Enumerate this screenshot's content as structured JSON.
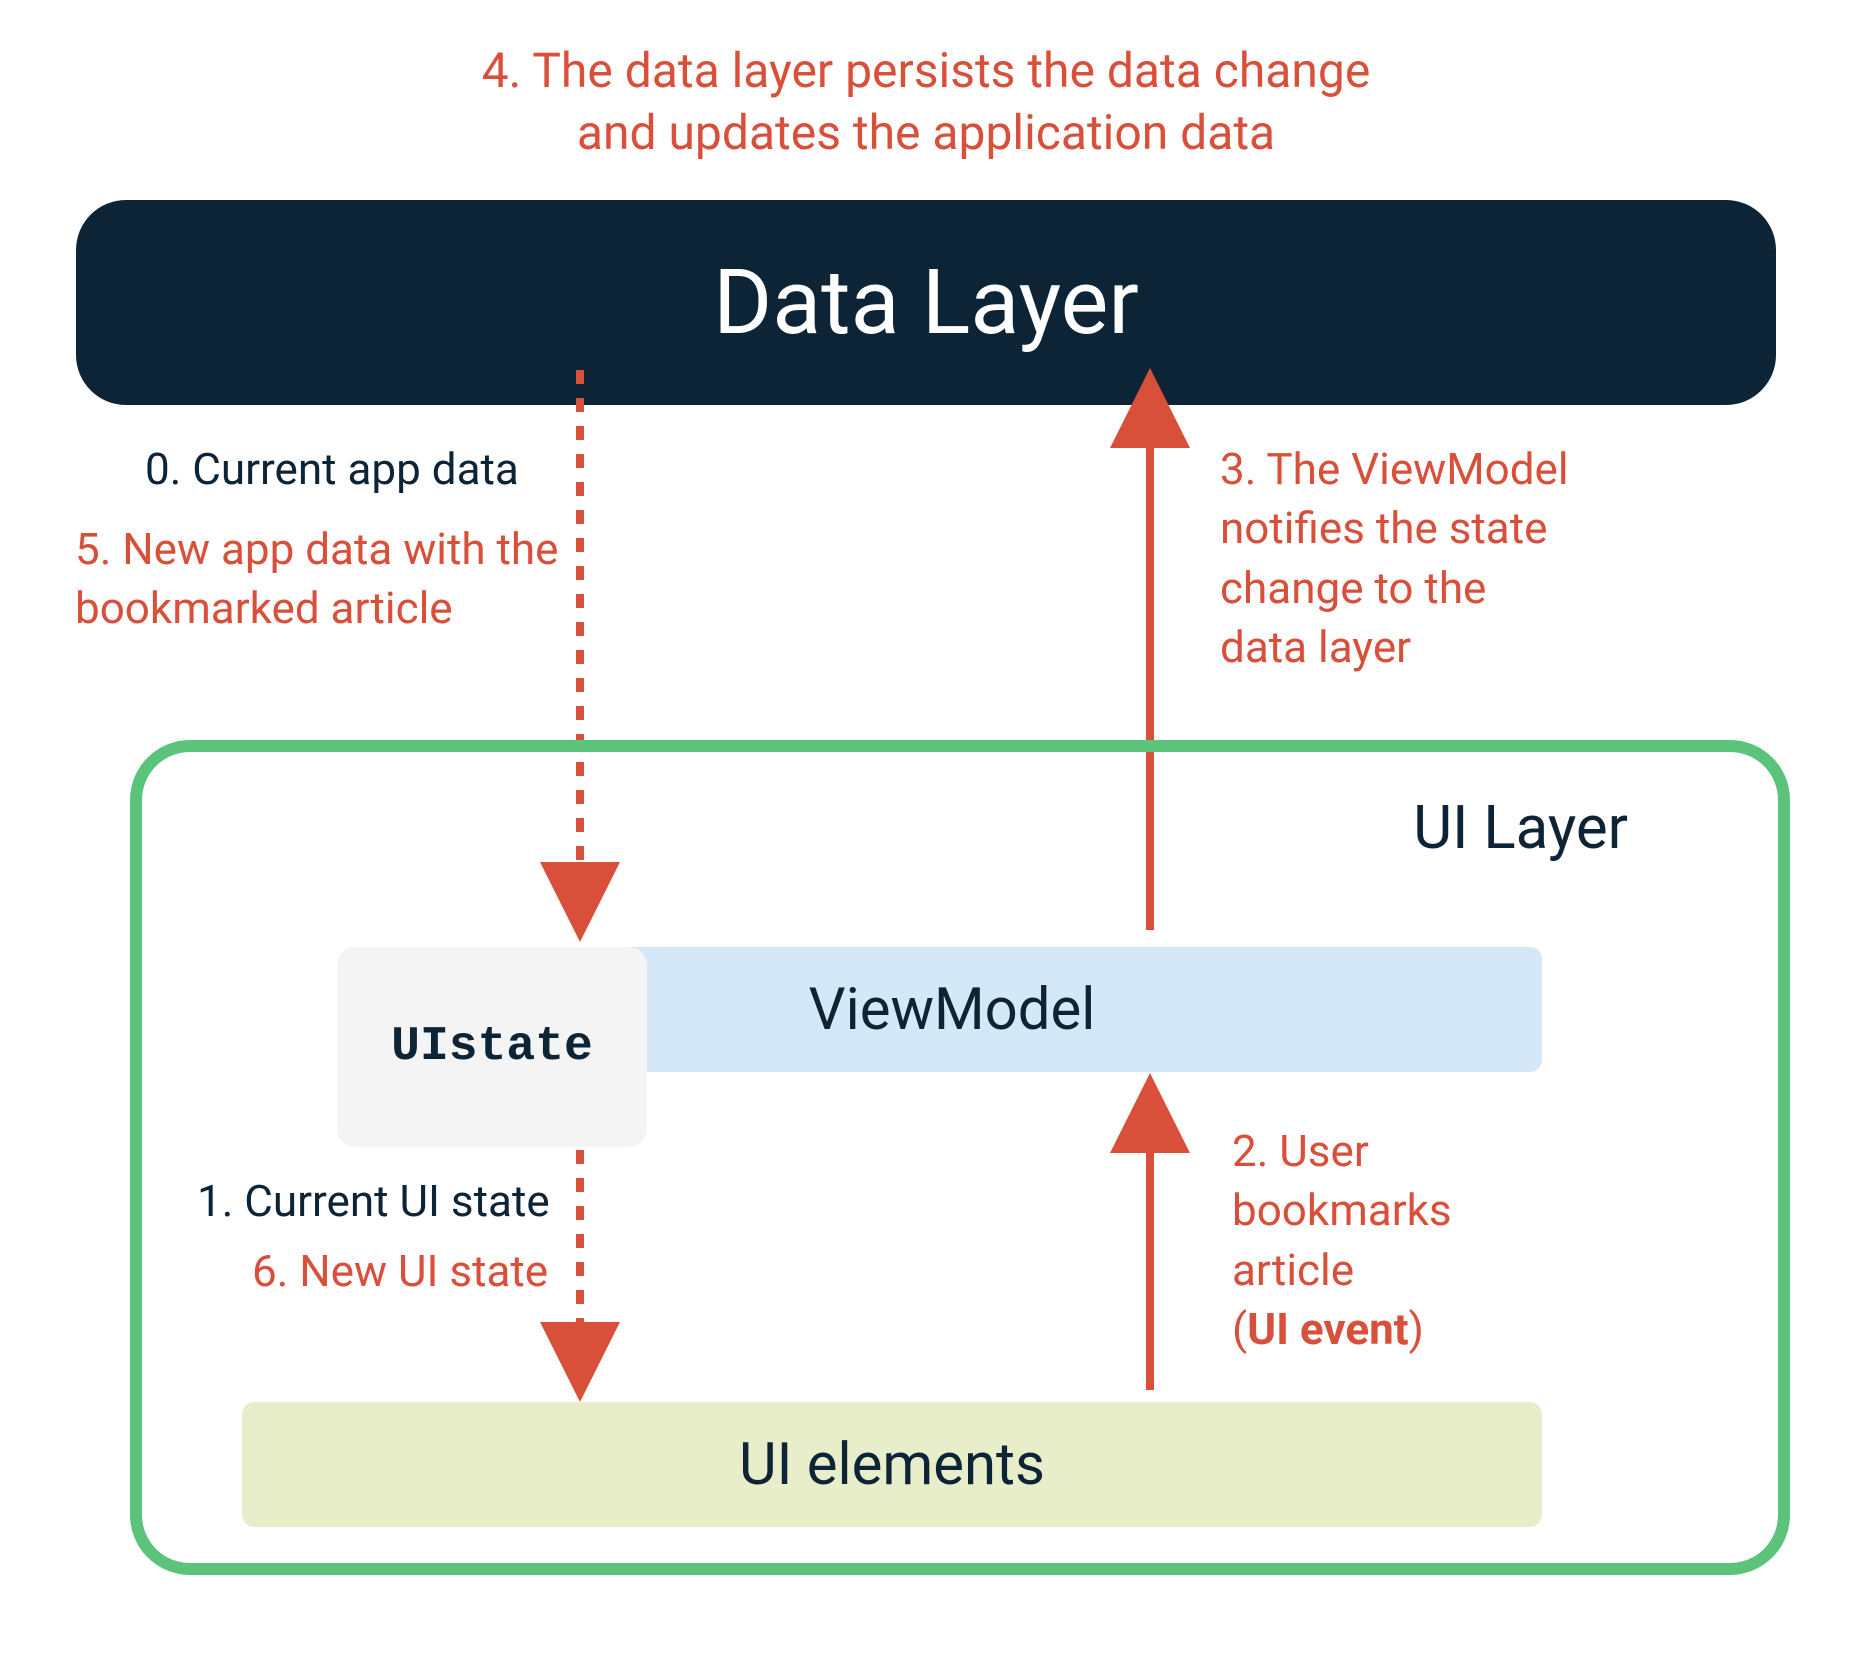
{
  "caption_top_line1": "4. The data layer persists the data change",
  "caption_top_line2": "and updates the application data",
  "boxes": {
    "data_layer": "Data Layer",
    "ui_layer": "UI Layer",
    "viewmodel": "ViewModel",
    "ui_state_line1": "UI",
    "ui_state_line2": "state",
    "ui_elements": "UI elements"
  },
  "labels": {
    "step0": "0. Current app data",
    "step5_line1": "5. New app data with the",
    "step5_line2": "bookmarked article",
    "step3_line1": "3. The ViewModel",
    "step3_line2": "notifies the state",
    "step3_line3": "change to the",
    "step3_line4": "data layer",
    "step1": "1. Current UI state",
    "step6": "6. New UI state",
    "step2_line1": "2. User",
    "step2_line2": "bookmarks",
    "step2_line3": "article",
    "step2_line4a": "(",
    "step2_line4b": "UI event",
    "step2_line4c": ")"
  },
  "colors": {
    "dark": "#0d2436",
    "red": "#d84f3a",
    "green": "#5bc47a",
    "lightblue": "#d4e8f7",
    "lightgreen": "#e8eec9",
    "lightgray": "#f4f4f4"
  }
}
